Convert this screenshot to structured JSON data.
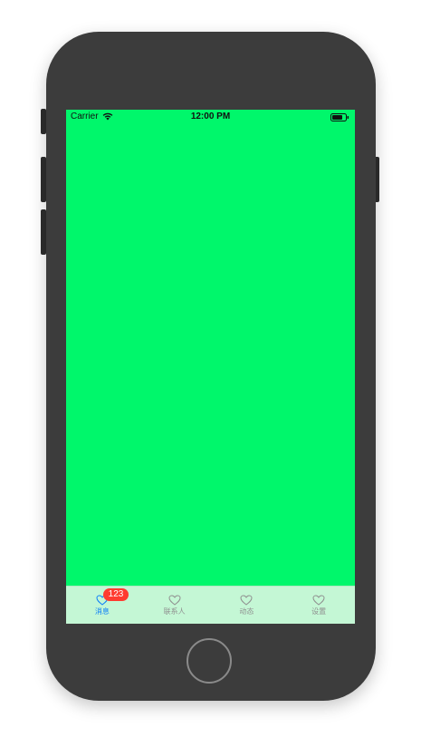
{
  "device": {
    "body_color": "#3c3c3c",
    "screen_color": "#00f76b"
  },
  "status_bar": {
    "carrier": "Carrier",
    "time": "12:00 PM",
    "wifi_icon": "wifi-icon",
    "battery_icon": "battery-icon"
  },
  "tab_bar": {
    "background": "#c4f7d5",
    "active_color": "#0a7ef8",
    "inactive_color": "#8f8f8f",
    "tabs": [
      {
        "label": "消息",
        "icon": "heart-outline-icon",
        "active": true,
        "badge": "123"
      },
      {
        "label": "联系人",
        "icon": "heart-outline-icon",
        "active": false
      },
      {
        "label": "动态",
        "icon": "heart-outline-icon",
        "active": false
      },
      {
        "label": "设置",
        "icon": "heart-outline-icon",
        "active": false
      }
    ]
  },
  "badge_color": "#ff3b30"
}
